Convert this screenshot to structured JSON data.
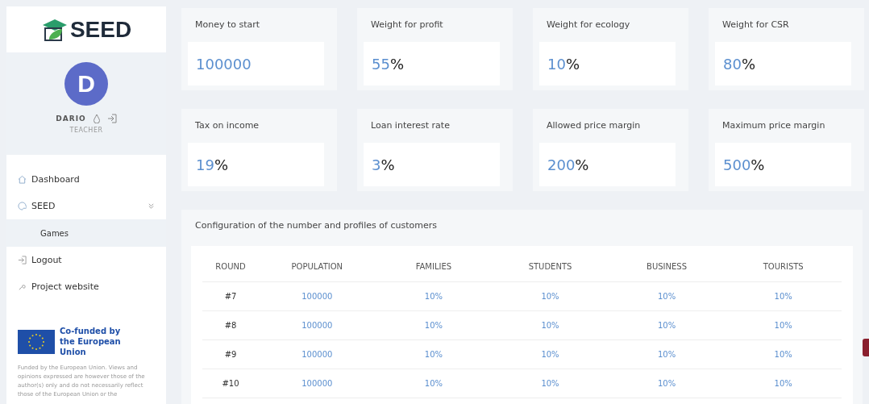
{
  "sidebar": {
    "logo": "SEED",
    "user": {
      "initial": "D",
      "name": "DARIO",
      "role": "TEACHER"
    },
    "menu": [
      {
        "label": "Dashboard",
        "kind": "home",
        "selected": false
      },
      {
        "label": "SEED",
        "kind": "palette",
        "selected": false,
        "expanded": true,
        "children": [
          {
            "label": "Games",
            "selected": true
          }
        ]
      },
      {
        "label": "Logout",
        "kind": "logout",
        "selected": false
      },
      {
        "label": "Project website",
        "kind": "link",
        "selected": false
      }
    ],
    "eu": {
      "label": "Co-funded by the European Union",
      "disclaimer": "Funded by the European Union. Views and opinions expressed are however those of the author(s) only and do not necessarily reflect those of the European Union or the"
    }
  },
  "settings": [
    {
      "label": "Money to start",
      "value": "100000"
    },
    {
      "label": "Weight for profit",
      "value": "55",
      "unit": "%"
    },
    {
      "label": "Weight for ecology",
      "value": "10",
      "unit": "%"
    },
    {
      "label": "Weight for CSR",
      "value": "80",
      "unit": "%"
    },
    {
      "label": "Tax on income",
      "value": "19",
      "unit": "%"
    },
    {
      "label": "Loan interest rate",
      "value": "3",
      "unit": "%"
    },
    {
      "label": "Allowed price margin",
      "value": "200",
      "unit": "%"
    },
    {
      "label": "Maximum price margin",
      "value": "500",
      "unit": "%"
    }
  ],
  "customers": {
    "title": "Configuration of the number and profiles of customers",
    "columns": [
      "ROUND",
      "POPULATION",
      "FAMILIES",
      "STUDENTS",
      "BUSINESS",
      "TOURISTS"
    ],
    "rows": [
      [
        "#7",
        "100000",
        "10%",
        "10%",
        "10%",
        "10%"
      ],
      [
        "#8",
        "100000",
        "10%",
        "10%",
        "10%",
        "10%"
      ],
      [
        "#9",
        "100000",
        "10%",
        "10%",
        "10%",
        "10%"
      ],
      [
        "#10",
        "100000",
        "10%",
        "10%",
        "10%",
        "10%"
      ]
    ]
  }
}
